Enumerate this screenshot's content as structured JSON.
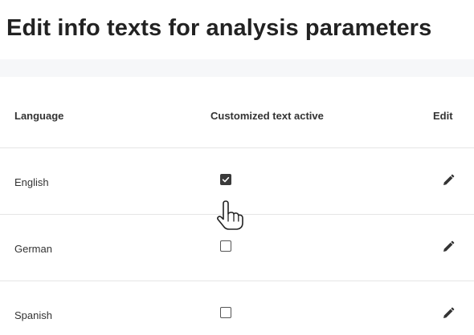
{
  "page": {
    "title": "Edit info texts for analysis parameters"
  },
  "table": {
    "columns": {
      "language": "Language",
      "customized_text_active": "Customized text active",
      "edit": "Edit"
    },
    "rows": [
      {
        "language": "English",
        "customized_text_active": true
      },
      {
        "language": "German",
        "customized_text_active": false
      },
      {
        "language": "Spanish",
        "customized_text_active": false
      }
    ]
  },
  "icons": {
    "edit": "pencil-icon",
    "checkbox_checked": "check-icon",
    "cursor": "hand-pointer-cursor"
  },
  "colors": {
    "band": "#f6f7f9",
    "divider": "#e6e6e6",
    "checkbox_checked_fill": "#3a3a3a",
    "text": "#333333"
  }
}
